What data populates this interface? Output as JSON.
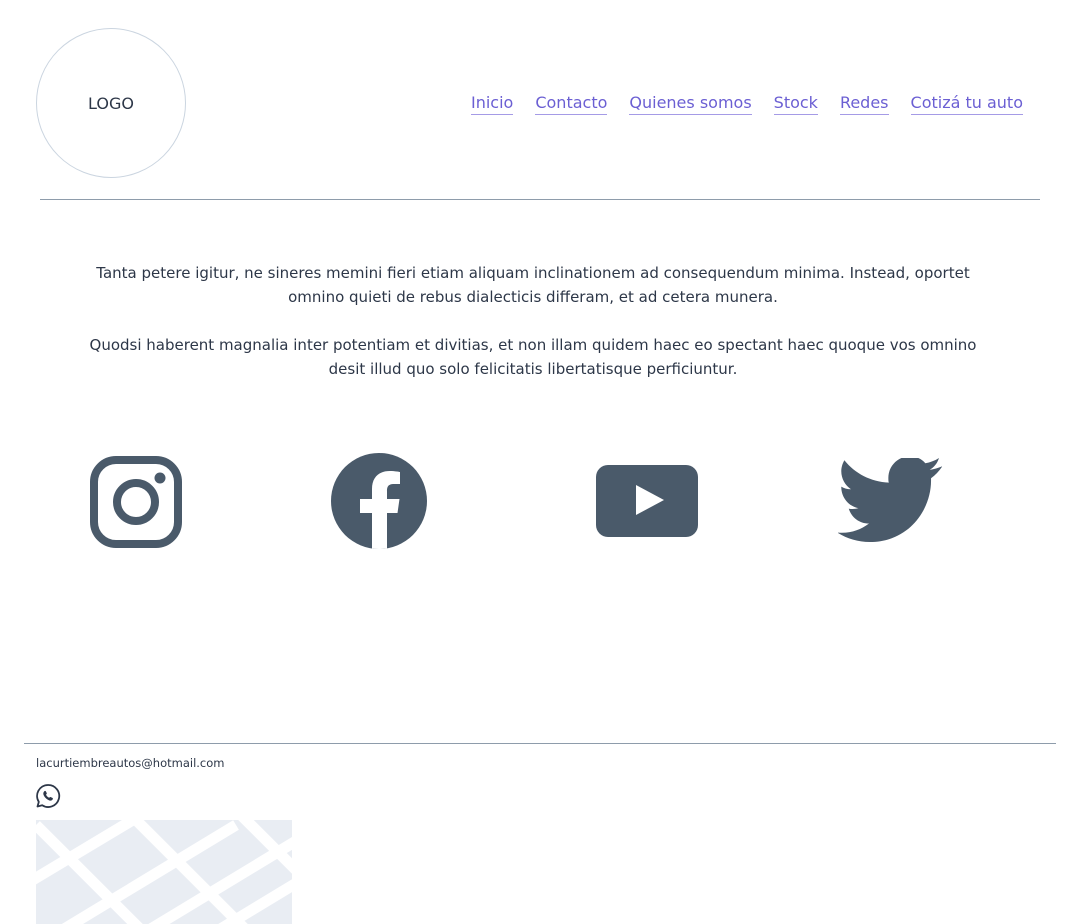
{
  "header": {
    "logo_text": "LOGO",
    "nav": [
      {
        "label": "Inicio"
      },
      {
        "label": "Contacto"
      },
      {
        "label": "Quienes somos"
      },
      {
        "label": "Stock"
      },
      {
        "label": "Redes"
      },
      {
        "label": "Cotizá tu auto"
      }
    ]
  },
  "main": {
    "paragraphs": [
      "Tanta petere igitur, ne sineres memini fieri etiam aliquam inclinationem ad consequendum minima. Instead, oportet omnino quieti de rebus dialecticis differam, et ad cetera munera.",
      "Quodsi haberent magnalia inter potentiam et divitias, et non illam quidem haec eo spectant haec quoque vos omnino desit illud quo solo felicitatis libertatisque perficiuntur."
    ],
    "social_icons": [
      "instagram-icon",
      "facebook-icon",
      "youtube-icon",
      "twitter-icon"
    ]
  },
  "footer": {
    "email": "lacurtiembreautos@hotmail.com",
    "whatsapp_icon": "whatsapp-icon"
  },
  "colors": {
    "link": "#6b5fd3",
    "icon": "#4a5a6a",
    "rule": "#8e9cab",
    "map_bg": "#e9edf3"
  }
}
